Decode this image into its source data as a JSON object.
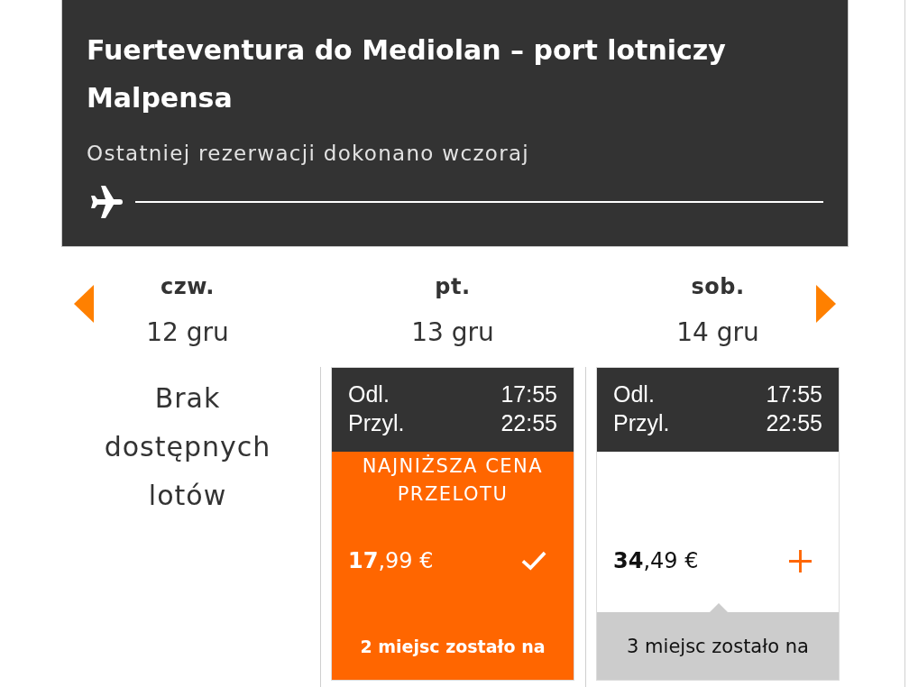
{
  "route": {
    "title": "Fuerteventura do Mediolan – port lotniczy Malpensa",
    "subtitle": "Ostatniej rezerwacji dokonano wczoraj"
  },
  "days": [
    {
      "kind": "empty",
      "weekday": "czw.",
      "date": "12 gru",
      "message": "Brak dostępnych lotów"
    },
    {
      "kind": "flight",
      "weekday": "pt.",
      "date": "13 gru",
      "selected": true,
      "departure_label": "Odl.",
      "departure_time": "17:55",
      "arrival_label": "Przyl.",
      "arrival_time": "22:55",
      "badge": "NAJNIŻSZA CENA PRZELOTU",
      "price": "**17**,99 €",
      "seats": "2 miejsc zostało na"
    },
    {
      "kind": "flight",
      "weekday": "sob.",
      "date": "14 gru",
      "selected": false,
      "departure_label": "Odl.",
      "departure_time": "17:55",
      "arrival_label": "Przyl.",
      "arrival_time": "22:55",
      "price": "**34**,49 €",
      "seats": "3 miejsc zostało na"
    }
  ]
}
